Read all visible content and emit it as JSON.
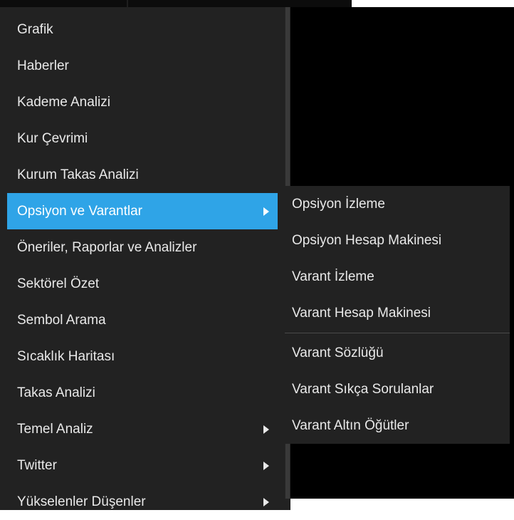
{
  "main_menu": {
    "items": [
      {
        "label": "Grafik"
      },
      {
        "label": "Haberler"
      },
      {
        "label": "Kademe Analizi"
      },
      {
        "label": "Kur Çevrimi"
      },
      {
        "label": "Kurum Takas Analizi"
      },
      {
        "label": "Opsiyon ve Varantlar"
      },
      {
        "label": "Öneriler, Raporlar ve Analizler"
      },
      {
        "label": "Sektörel Özet"
      },
      {
        "label": "Sembol Arama"
      },
      {
        "label": "Sıcaklık Haritası"
      },
      {
        "label": "Takas Analizi"
      },
      {
        "label": "Temel Analiz"
      },
      {
        "label": "Twitter"
      },
      {
        "label": "Yükselenler Düşenler"
      }
    ]
  },
  "submenu": {
    "group1": [
      {
        "label": "Opsiyon İzleme"
      },
      {
        "label": "Opsiyon Hesap Makinesi"
      },
      {
        "label": "Varant İzleme"
      },
      {
        "label": "Varant Hesap Makinesi"
      }
    ],
    "group2": [
      {
        "label": "Varant Sözlüğü"
      },
      {
        "label": "Varant Sıkça Sorulanlar"
      },
      {
        "label": "Varant Altın Öğütler"
      }
    ]
  },
  "colors": {
    "menu_background": "#222222",
    "highlight": "#2fa4e7",
    "text": "#e9e9e9"
  },
  "icons": {
    "submenu_arrow": "triangle-right-icon"
  }
}
